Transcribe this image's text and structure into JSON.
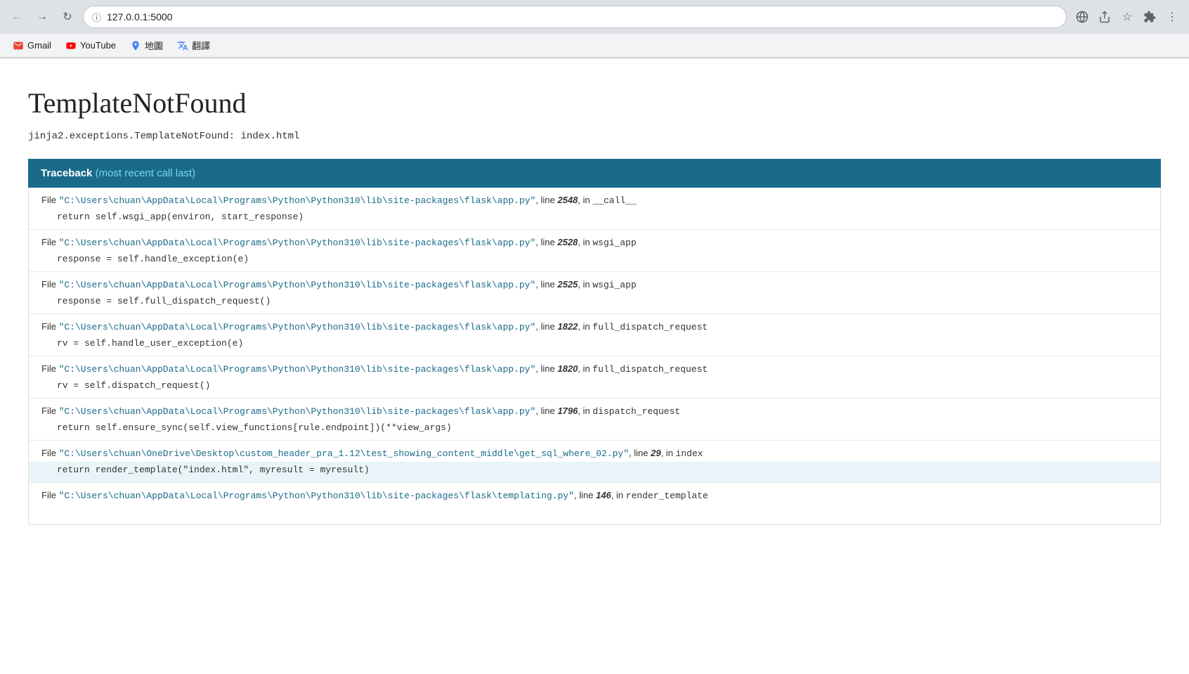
{
  "browser": {
    "address": "127.0.0.1:5000",
    "back_title": "Back",
    "forward_title": "Forward",
    "reload_title": "Reload"
  },
  "bookmarks": [
    {
      "label": "Gmail",
      "icon": "gmail"
    },
    {
      "label": "YouTube",
      "icon": "youtube"
    },
    {
      "label": "地圖",
      "icon": "maps"
    },
    {
      "label": "翻譯",
      "icon": "translate"
    }
  ],
  "error": {
    "title": "TemplateNotFound",
    "subtitle": "jinja2.exceptions.TemplateNotFound: index.html",
    "traceback_header": "Traceback",
    "traceback_subheader": "(most recent call last)",
    "entries": [
      {
        "file": "\"C:\\Users\\chuan\\AppData\\Local\\Programs\\Python\\Python310\\lib\\site-packages\\flask\\app.py\"",
        "line": "2548",
        "func": "__call__",
        "code": "return self.wsgi_app(environ, start_response)"
      },
      {
        "file": "\"C:\\Users\\chuan\\AppData\\Local\\Programs\\Python\\Python310\\lib\\site-packages\\flask\\app.py\"",
        "line": "2528",
        "func": "wsgi_app",
        "code": "response = self.handle_exception(e)"
      },
      {
        "file": "\"C:\\Users\\chuan\\AppData\\Local\\Programs\\Python\\Python310\\lib\\site-packages\\flask\\app.py\"",
        "line": "2525",
        "func": "wsgi_app",
        "code": "response = self.full_dispatch_request()"
      },
      {
        "file": "\"C:\\Users\\chuan\\AppData\\Local\\Programs\\Python\\Python310\\lib\\site-packages\\flask\\app.py\"",
        "line": "1822",
        "func": "full_dispatch_request",
        "code": "rv = self.handle_user_exception(e)"
      },
      {
        "file": "\"C:\\Users\\chuan\\AppData\\Local\\Programs\\Python\\Python310\\lib\\site-packages\\flask\\app.py\"",
        "line": "1820",
        "func": "full_dispatch_request",
        "code": "rv = self.dispatch_request()"
      },
      {
        "file": "\"C:\\Users\\chuan\\AppData\\Local\\Programs\\Python\\Python310\\lib\\site-packages\\flask\\app.py\"",
        "line": "1796",
        "func": "dispatch_request",
        "code": "return self.ensure_sync(self.view_functions[rule.endpoint])(**view_args)"
      },
      {
        "file": "\"C:\\Users\\chuan\\OneDrive\\Desktop\\custom_header_pra_1.12\\test_showing_content_middle\\get_sql_where_02.py\"",
        "line": "29",
        "func": "index",
        "code": "return render_template(\"index.html\", myresult = myresult)",
        "highlight": true
      },
      {
        "file": "\"C:\\Users\\chuan\\AppData\\Local\\Programs\\Python\\Python310\\lib\\site-packages\\flask\\templating.py\"",
        "line": "146",
        "func": "render_template",
        "code": ""
      }
    ]
  }
}
